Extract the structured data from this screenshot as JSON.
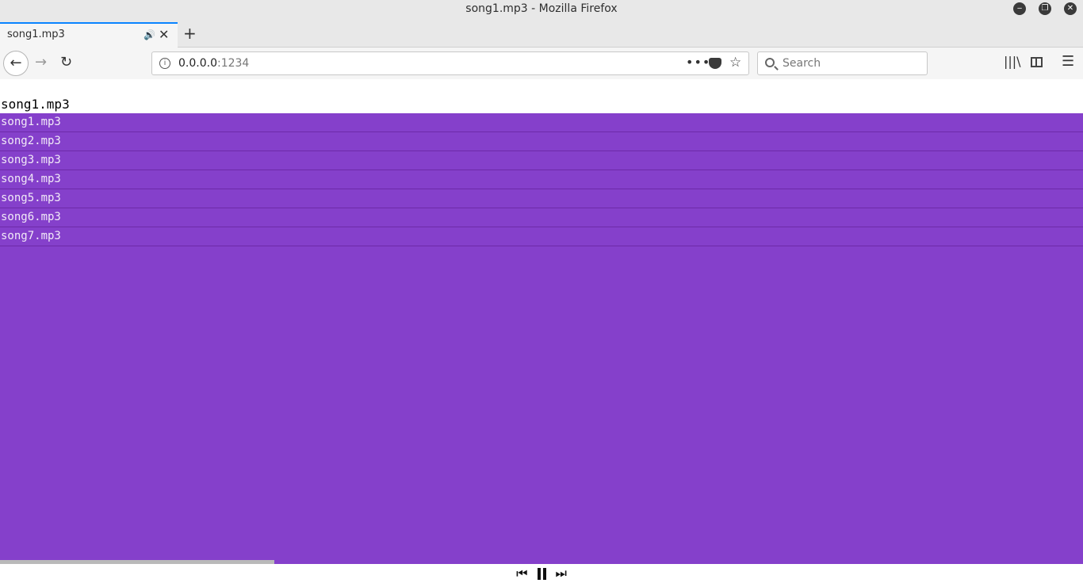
{
  "window": {
    "title": "song1.mp3 - Mozilla Firefox",
    "controls": {
      "minimize": "‒",
      "maximize": "❐",
      "close": "✕"
    }
  },
  "tab": {
    "title": "song1.mp3",
    "audio_icon": "speaker-icon",
    "close_glyph": "✕",
    "new_tab_glyph": "+"
  },
  "nav": {
    "back_glyph": "←",
    "forward_glyph": "→",
    "reload_glyph": "↻",
    "url_host": "0.0.0.0",
    "url_port": ":1234",
    "more_glyph": "•••",
    "star_glyph": "☆",
    "search_placeholder": "Search",
    "library_glyph": "|||\\",
    "menu_glyph": "☰"
  },
  "player": {
    "now_playing": "song1.mp3",
    "playlist": [
      "song1.mp3",
      "song2.mp3",
      "song3.mp3",
      "song4.mp3",
      "song5.mp3",
      "song6.mp3",
      "song7.mp3"
    ],
    "progress_fraction": 0.253,
    "prev_glyph": "⏮",
    "next_glyph": "⏭",
    "background_color": "#8540cb"
  }
}
